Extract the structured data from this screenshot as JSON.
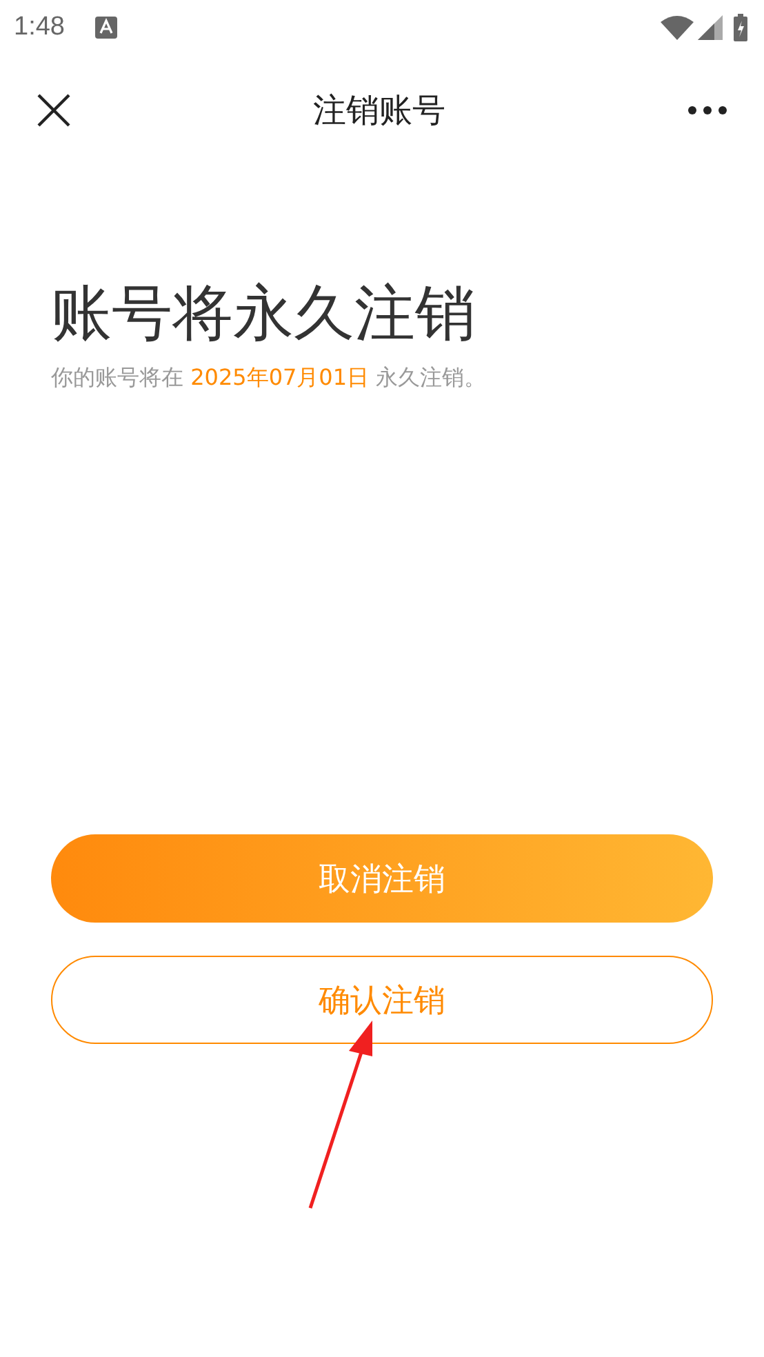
{
  "status_bar": {
    "time": "1:48"
  },
  "nav": {
    "title": "注销账号"
  },
  "heading": "账号将永久注销",
  "notice": {
    "before": "你的账号将在",
    "date": "2025年07月01日",
    "after": "永久注销。"
  },
  "buttons": [
    {
      "label": "取消注销",
      "kind": "primary"
    },
    {
      "label": "确认注销",
      "kind": "outline"
    }
  ]
}
